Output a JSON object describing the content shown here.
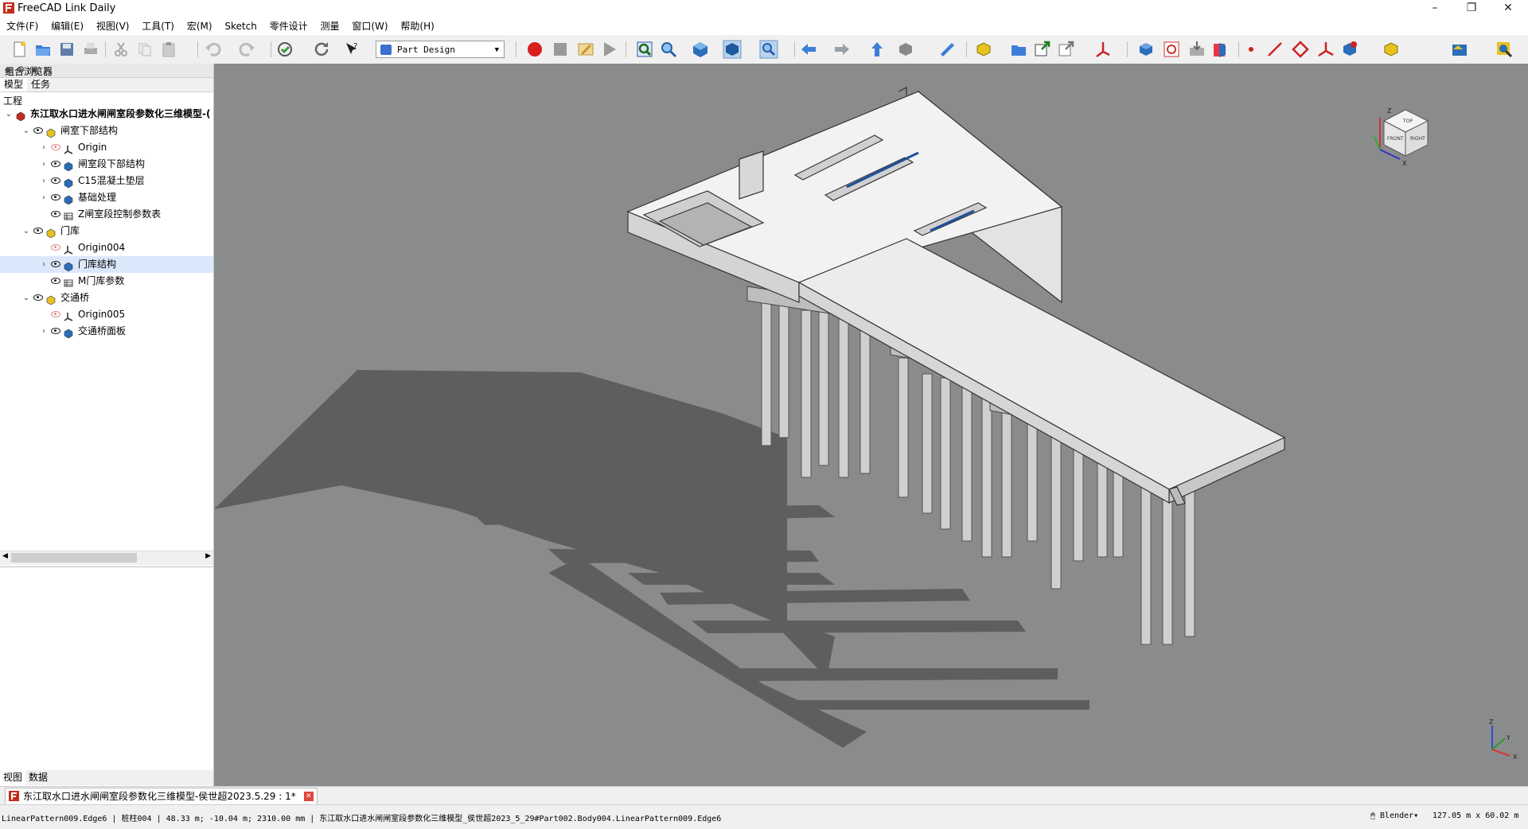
{
  "window": {
    "title": "FreeCAD Link Daily",
    "minimize": "–",
    "restore": "❐",
    "close": "✕"
  },
  "menu": [
    "文件(F)",
    "编辑(E)",
    "视图(V)",
    "工具(T)",
    "宏(M)",
    "Sketch",
    "零件设计",
    "测量",
    "窗口(W)",
    "帮助(H)"
  ],
  "toolbar": {
    "workbench": "Part Design",
    "icons": [
      "new-file",
      "open-file",
      "save",
      "print",
      "cut",
      "copy",
      "paste",
      "undo",
      "redo",
      "refresh-recompute",
      "refresh",
      "whats-this",
      "record-macro",
      "stop-macro",
      "edit-macro",
      "run-macro",
      "fit-all",
      "zoom-select",
      "view-cube-dropdown",
      "draw-style",
      "zoom-box",
      "nav-back",
      "nav-forward",
      "nav-up",
      "box-select",
      "measure",
      "part",
      "group",
      "link",
      "link-actions",
      "datum",
      "body",
      "clone",
      "export",
      "import",
      "point",
      "line",
      "plane",
      "lcs",
      "shape-binder",
      "lock",
      "drawing",
      "inspect"
    ]
  },
  "combo_view": {
    "title": "组合浏览器",
    "tabs": [
      "模型",
      "任务"
    ],
    "section_label": "工程",
    "tree": [
      {
        "label": "东江取水口进水闸闸室段参数化三维模型-(",
        "level": 0,
        "expanded": true,
        "icon": "document",
        "bold": true
      },
      {
        "label": "闸室下部结构",
        "level": 1,
        "expanded": true,
        "icon": "part",
        "visible": true
      },
      {
        "label": "Origin",
        "level": 2,
        "expanded": false,
        "icon": "origin",
        "visible": false
      },
      {
        "label": "闸室段下部结构",
        "level": 2,
        "expanded": false,
        "icon": "body",
        "visible": true
      },
      {
        "label": "C15混凝土垫层",
        "level": 2,
        "expanded": false,
        "icon": "body",
        "visible": true
      },
      {
        "label": "基础处理",
        "level": 2,
        "expanded": false,
        "icon": "body",
        "visible": true
      },
      {
        "label": "Z闸室段控制参数表",
        "level": 2,
        "expanded": null,
        "icon": "spreadsheet",
        "visible": true
      },
      {
        "label": "门库",
        "level": 1,
        "expanded": true,
        "icon": "part",
        "visible": true
      },
      {
        "label": "Origin004",
        "level": 2,
        "expanded": null,
        "icon": "origin",
        "visible": false
      },
      {
        "label": "门库结构",
        "level": 2,
        "expanded": false,
        "icon": "body",
        "visible": true,
        "selected": true
      },
      {
        "label": "M门库参数",
        "level": 2,
        "expanded": null,
        "icon": "spreadsheet",
        "visible": true
      },
      {
        "label": "交通桥",
        "level": 1,
        "expanded": true,
        "icon": "part",
        "visible": true
      },
      {
        "label": "Origin005",
        "level": 2,
        "expanded": null,
        "icon": "origin",
        "visible": false
      },
      {
        "label": "交通桥面板",
        "level": 2,
        "expanded": false,
        "icon": "body",
        "visible": true
      }
    ],
    "bottom_tabs": [
      "视图",
      "数据"
    ]
  },
  "viewport": {
    "background": "#8a8b8c",
    "navcube_labels": [
      "TOP",
      "FRONT",
      "RIGHT"
    ],
    "axis_labels": [
      "Z",
      "X",
      "Y"
    ]
  },
  "document_tab": {
    "label": "东江取水口进水闸闸室段参数化三维模型-侯世超2023.5.29 : 1*"
  },
  "statusbar": {
    "message": "LinearPattern009.Edge6 | 桩柱004 | 48.33 m; -10.04 m; 2310.00 mm | 东江取水口进水闸闸室段参数化三维模型_侯世超2023_5_29#Part002.Body004.LinearPattern009.Edge6",
    "navigation_style": "Blender",
    "dimensions": "127.05 m x 60.02 m"
  }
}
